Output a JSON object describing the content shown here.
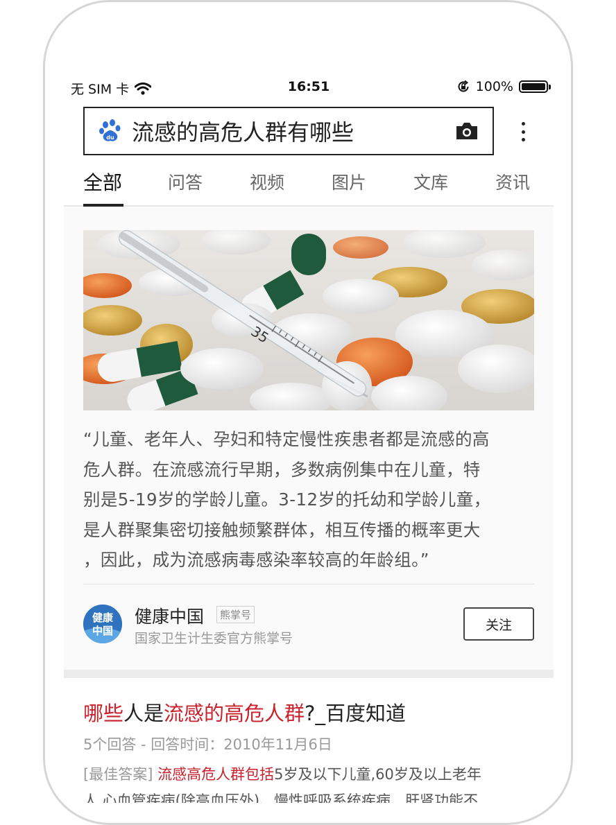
{
  "status_bar": {
    "carrier": "无 SIM 卡",
    "time": "16:51",
    "battery": "100%"
  },
  "search": {
    "query": "流感的高危人群有哪些",
    "icon": "baidu-paw-icon"
  },
  "tabs": [
    {
      "label": "全部",
      "active": true
    },
    {
      "label": "问答"
    },
    {
      "label": "视频"
    },
    {
      "label": "图片"
    },
    {
      "label": "文库"
    },
    {
      "label": "资讯"
    }
  ],
  "card": {
    "image_alt": "pills and thermometer",
    "thermometer_mark": "35",
    "quote_lines": [
      "“儿童、老年人、孕妇和特定慢性疾患者都是流感的高",
      "危人群。在流感流行早期，多数病例集中在儿童，特",
      "别是5-19岁的学龄儿童。3-12岁的托幼和学龄儿童，",
      "是人群聚集密切接触频繁群体，相互传播的概率更大",
      "，因此，成为流感病毒感染率较高的年龄组。”"
    ],
    "author": {
      "logo_text_1": "健康",
      "logo_text_2": "中国",
      "name": "健康中国",
      "badge": "熊掌号",
      "subtitle": "国家卫生计生委官方熊掌号",
      "follow_label": "关注"
    }
  },
  "result": {
    "title_parts": [
      {
        "text": "哪些",
        "hl": true
      },
      {
        "text": "人是",
        "hl": false
      },
      {
        "text": "流感的高危人群",
        "hl": true
      },
      {
        "text": "?_百度知道",
        "hl": false
      }
    ],
    "meta": "5个回答 - 回答时间：2010年11月6日",
    "snippet_tag": "[最佳答案]",
    "snippet_hl": "流感高危人群包括",
    "snippet_rest": "5岁及以下儿童,60岁及以上老年",
    "snippet_line2": "人,心血管疾病(除高血压外)、慢性呼吸系统疾病、肝肾功能不"
  },
  "colors": {
    "highlight": "#c9222d",
    "text_main": "#222222",
    "text_sub": "#999999"
  }
}
